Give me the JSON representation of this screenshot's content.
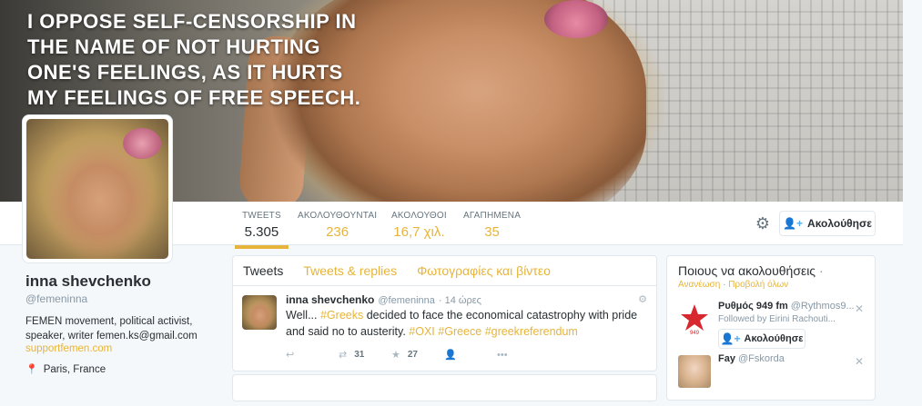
{
  "banner": {
    "quote": "I oppose self-censorship in the name of not hurting one's feelings, as it hurts my feelings of free speech."
  },
  "stats": [
    {
      "label": "TWEETS",
      "value": "5.305"
    },
    {
      "label": "ΑΚΟΛΟΥΘΟΥΝΤΑΙ",
      "value": "236"
    },
    {
      "label": "ΑΚΟΛΟΥΘΟΙ",
      "value": "16,7 χιλ."
    },
    {
      "label": "ΑΓΑΠΗΜΕΝΑ",
      "value": "35"
    }
  ],
  "header_actions": {
    "gear_icon": "gear-icon",
    "follow_label": "Ακολούθησε"
  },
  "profile": {
    "name": "inna shevchenko",
    "handle": "@femeninna",
    "bio": "FEMEN movement, political activist, speaker, writer femen.ks@gmail.com",
    "link": "supportfemen.com",
    "location": "Paris, France"
  },
  "timeline": {
    "tabs": [
      "Tweets",
      "Tweets & replies",
      "Φωτογραφίες και βίντεο"
    ],
    "tweet": {
      "name": "inna shevchenko",
      "handle": "@femeninna",
      "time": "· 14 ώρες",
      "text_parts": [
        "Well... ",
        "#Greeks",
        " decided to face the economical catastrophy with pride and said no to austerity. ",
        "#OXI",
        " ",
        "#Greece",
        " ",
        "#greekreferendum"
      ],
      "retweets": "31",
      "favorites": "27"
    }
  },
  "who_to_follow": {
    "title": "Ποιους να ακολουθήσεις",
    "refresh": "Ανανέωση",
    "view_all": "Προβολή όλων",
    "suggestions": [
      {
        "name": "Ρυθμός 949 fm",
        "handle": "@Rythmos9...",
        "followed_by": "Followed by Eirini Rachouti...",
        "follow_label": "Ακολούθησε"
      },
      {
        "name": "Fay",
        "handle": "@Fskorda"
      }
    ]
  },
  "colors": {
    "accent": "#e6b43b",
    "text": "#292f33",
    "muted": "#8899a6",
    "blue": "#55acee"
  }
}
